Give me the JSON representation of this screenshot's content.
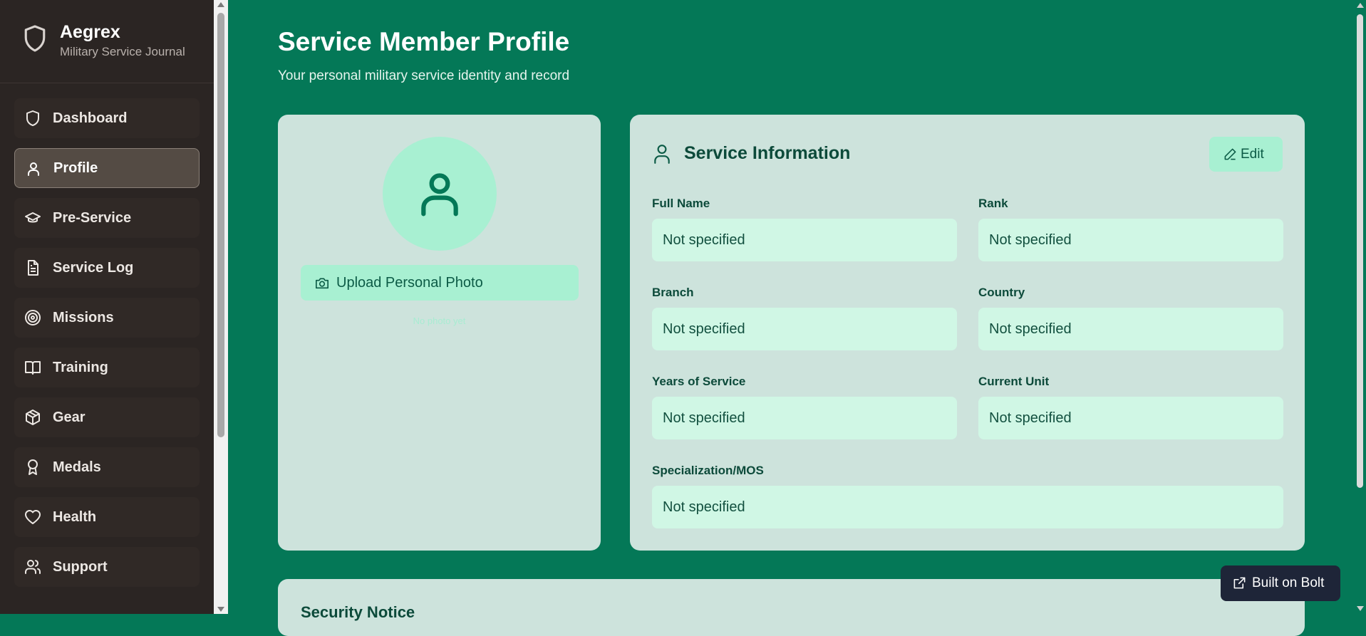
{
  "brand": {
    "title": "Aegrex",
    "subtitle": "Military Service Journal"
  },
  "sidebar": {
    "items": [
      {
        "label": "Dashboard",
        "icon": "shield-icon",
        "active": false
      },
      {
        "label": "Profile",
        "icon": "user-icon",
        "active": true
      },
      {
        "label": "Pre-Service",
        "icon": "graduation-cap-icon",
        "active": false
      },
      {
        "label": "Service Log",
        "icon": "document-icon",
        "active": false
      },
      {
        "label": "Missions",
        "icon": "target-icon",
        "active": false
      },
      {
        "label": "Training",
        "icon": "book-icon",
        "active": false
      },
      {
        "label": "Gear",
        "icon": "package-icon",
        "active": false
      },
      {
        "label": "Medals",
        "icon": "award-icon",
        "active": false
      },
      {
        "label": "Health",
        "icon": "heart-icon",
        "active": false
      },
      {
        "label": "Support",
        "icon": "users-icon",
        "active": false
      }
    ]
  },
  "header": {
    "title": "Service Member Profile",
    "subtitle": "Your personal military service identity and record"
  },
  "photo": {
    "upload_label": "Upload Personal Photo",
    "no_photo_text": "No photo yet"
  },
  "service_info": {
    "title": "Service Information",
    "edit_label": "Edit",
    "fields": [
      {
        "label": "Full Name",
        "value": "Not specified"
      },
      {
        "label": "Rank",
        "value": "Not specified"
      },
      {
        "label": "Branch",
        "value": "Not specified"
      },
      {
        "label": "Country",
        "value": "Not specified"
      },
      {
        "label": "Years of Service",
        "value": "Not specified"
      },
      {
        "label": "Current Unit",
        "value": "Not specified"
      },
      {
        "label": "Specialization/MOS",
        "value": "Not specified"
      }
    ]
  },
  "notice": {
    "title": "Security Notice"
  },
  "badge": {
    "label": "Built on Bolt"
  },
  "colors": {
    "background": "#047857",
    "sidebar": "#2b2523",
    "card": "#cde3dc",
    "accent": "#a8f0d2",
    "field": "#d0f7e5"
  }
}
